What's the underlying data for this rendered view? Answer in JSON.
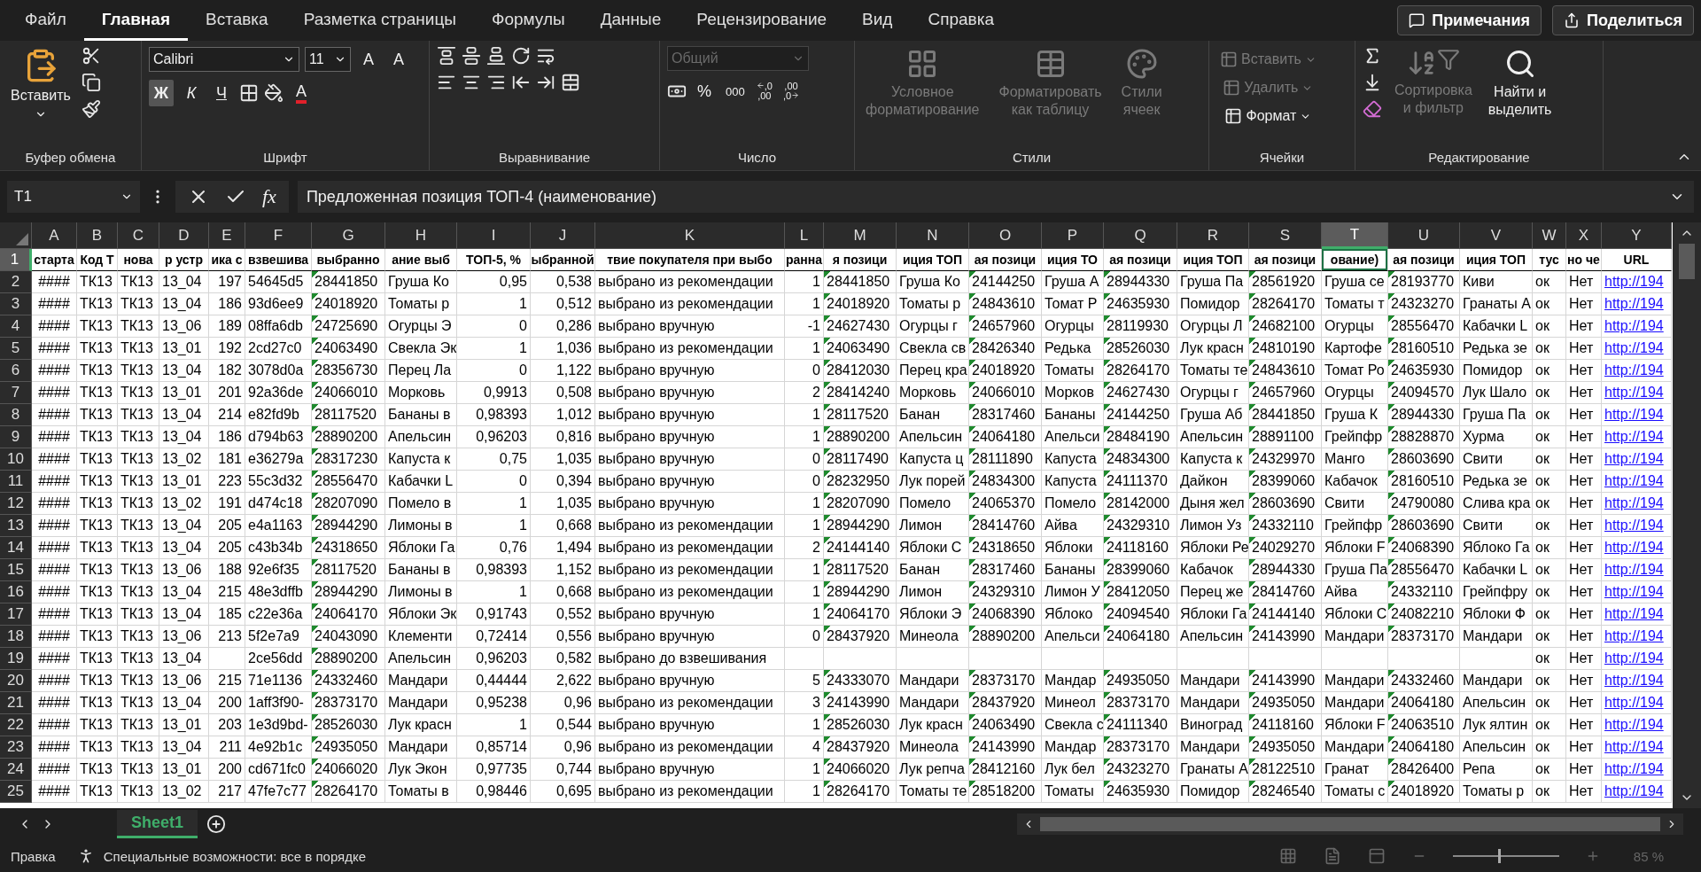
{
  "menu_tabs": [
    {
      "label": "Файл",
      "selected": false
    },
    {
      "label": "Главная",
      "selected": true
    },
    {
      "label": "Вставка",
      "selected": false
    },
    {
      "label": "Разметка страницы",
      "selected": false
    },
    {
      "label": "Формулы",
      "selected": false
    },
    {
      "label": "Данные",
      "selected": false
    },
    {
      "label": "Рецензирование",
      "selected": false
    },
    {
      "label": "Вид",
      "selected": false
    },
    {
      "label": "Справка",
      "selected": false
    }
  ],
  "actions": [
    {
      "label": "Примечания",
      "kind": "comments"
    },
    {
      "label": "Поделиться",
      "kind": "share"
    }
  ],
  "ribbon": [
    {
      "kind": "clipboard",
      "label": "Буфер обмена",
      "paste": "Вставить"
    },
    {
      "kind": "font",
      "label": "Шрифт",
      "font": "Calibri",
      "size": "11",
      "grow": "A",
      "shrink": "A",
      "font_color": "A",
      "styles": [
        {
          "label": "Ж",
          "selected": true
        },
        {
          "label": "К",
          "selected": false
        },
        {
          "label": "Ч",
          "selected": false
        }
      ]
    },
    {
      "kind": "alignment",
      "label": "Выравнивание"
    },
    {
      "kind": "number",
      "label": "Число",
      "format": "Общий",
      "format_disabled": true,
      "percent": "%",
      "thousands": "000",
      "decimals": [
        {
          "top": ",0",
          "bottom": ",00"
        },
        {
          "top": ",00",
          "bottom": ",0"
        }
      ]
    },
    {
      "kind": "styles",
      "label": "Стили",
      "items": [
        {
          "lines": [
            "Условное",
            "форматирование"
          ],
          "disabled": true
        },
        {
          "lines": [
            "Форматировать",
            "как таблицу"
          ],
          "disabled": true
        },
        {
          "lines": [
            "Стили",
            "ячеек"
          ],
          "disabled": true
        }
      ]
    },
    {
      "kind": "cells",
      "label": "Ячейки",
      "items": [
        {
          "label": "Вставить",
          "disabled": true
        },
        {
          "label": "Удалить",
          "disabled": true
        },
        {
          "label": "Формат",
          "disabled": false
        }
      ]
    },
    {
      "kind": "editing",
      "label": "Редактирование",
      "items": [
        {
          "lines": [
            "Сортировка",
            "и фильтр"
          ],
          "disabled": true
        },
        {
          "lines": [
            "Найти и",
            "выделить"
          ],
          "disabled": false
        }
      ]
    }
  ],
  "formula_bar": {
    "name_box": "T1",
    "fx": "fx",
    "formula": "Предложенная позиция ТОП-4 (наименование)"
  },
  "sheet": {
    "columns": [
      {
        "letter": "A",
        "selected": false,
        "kind": "center",
        "flagged": false
      },
      {
        "letter": "B",
        "selected": false,
        "kind": "text",
        "flagged": false
      },
      {
        "letter": "C",
        "selected": false,
        "kind": "text",
        "flagged": false
      },
      {
        "letter": "D",
        "selected": false,
        "kind": "text",
        "flagged": false
      },
      {
        "letter": "E",
        "selected": false,
        "kind": "number",
        "flagged": false
      },
      {
        "letter": "F",
        "selected": false,
        "kind": "text",
        "flagged": false
      },
      {
        "letter": "G",
        "selected": false,
        "kind": "text",
        "flagged": true
      },
      {
        "letter": "H",
        "selected": false,
        "kind": "text",
        "flagged": false
      },
      {
        "letter": "I",
        "selected": false,
        "kind": "number",
        "flagged": false
      },
      {
        "letter": "J",
        "selected": false,
        "kind": "number",
        "flagged": false
      },
      {
        "letter": "K",
        "selected": false,
        "kind": "text",
        "flagged": false
      },
      {
        "letter": "L",
        "selected": false,
        "kind": "number",
        "flagged": false
      },
      {
        "letter": "M",
        "selected": false,
        "kind": "text",
        "flagged": true
      },
      {
        "letter": "N",
        "selected": false,
        "kind": "text",
        "flagged": false
      },
      {
        "letter": "O",
        "selected": false,
        "kind": "text",
        "flagged": true
      },
      {
        "letter": "P",
        "selected": false,
        "kind": "text",
        "flagged": false
      },
      {
        "letter": "Q",
        "selected": false,
        "kind": "text",
        "flagged": true
      },
      {
        "letter": "R",
        "selected": false,
        "kind": "text",
        "flagged": false
      },
      {
        "letter": "S",
        "selected": false,
        "kind": "text",
        "flagged": true
      },
      {
        "letter": "T",
        "selected": true,
        "kind": "text",
        "flagged": false
      },
      {
        "letter": "U",
        "selected": false,
        "kind": "text",
        "flagged": true
      },
      {
        "letter": "V",
        "selected": false,
        "kind": "text",
        "flagged": false
      },
      {
        "letter": "W",
        "selected": false,
        "kind": "text",
        "flagged": false
      },
      {
        "letter": "X",
        "selected": false,
        "kind": "text",
        "flagged": false
      },
      {
        "letter": "Y",
        "selected": false,
        "kind": "link",
        "flagged": false
      }
    ],
    "header_row": {
      "number": "1",
      "selected": true,
      "cells": [
        "старта",
        "Код Т",
        "нова",
        "р устр",
        "ика с",
        "взвешива",
        "выбранно",
        "ание выб",
        "ТОП-5, %",
        "ыбранной",
        "твие покупателя при выбо",
        "ранна",
        "я позици",
        "иция ТОП",
        "ая позици",
        "иция ТО",
        "ая позици",
        "иция ТОП",
        "ая позици",
        "ование)",
        "ая позици",
        "иция ТОП",
        "тус",
        "но че",
        "URL"
      ]
    },
    "rows": [
      {
        "number": "2",
        "selected": false,
        "cells": [
          "####",
          "ТК13",
          "ТК13",
          "13_04",
          "197",
          "54645d5",
          "28441850",
          "Груша Ко",
          "0,95",
          "0,538",
          "выбрано из рекомендации",
          "1",
          "28441850",
          "Груша Ко",
          "24144250",
          "Груша А",
          "28944330",
          "Груша Па",
          "28561920",
          "Груша се",
          "28193770",
          "Киви",
          "ок",
          "Нет",
          "http://194"
        ]
      },
      {
        "number": "3",
        "selected": false,
        "cells": [
          "####",
          "ТК13",
          "ТК13",
          "13_04",
          "186",
          "93d6ee9",
          "24018920",
          "Томаты р",
          "1",
          "0,512",
          "выбрано из рекомендации",
          "1",
          "24018920",
          "Томаты р",
          "24843610",
          "Томат Р",
          "24635930",
          "Помидор",
          "28264170",
          "Томаты т",
          "24323270",
          "Гранаты А",
          "ок",
          "Нет",
          "http://194"
        ]
      },
      {
        "number": "4",
        "selected": false,
        "cells": [
          "####",
          "ТК13",
          "ТК13",
          "13_06",
          "189",
          "08ffa6db",
          "24725690",
          "Огурцы Э",
          "0",
          "0,286",
          "выбрано вручную",
          "-1",
          "24627430",
          "Огурцы г",
          "24657960",
          "Огурцы",
          "28119930",
          "Огурцы Л",
          "24682100",
          "Огурцы",
          "28556470",
          "Кабачки L",
          "ок",
          "Нет",
          "http://194"
        ]
      },
      {
        "number": "5",
        "selected": false,
        "cells": [
          "####",
          "ТК13",
          "ТК13",
          "13_01",
          "192",
          "2cd27c0",
          "24063490",
          "Свекла Эк",
          "1",
          "1,036",
          "выбрано из рекомендации",
          "1",
          "24063490",
          "Свекла св",
          "28426340",
          "Редька",
          "28526030",
          "Лук красн",
          "24810190",
          "Картофе",
          "28160510",
          "Редька зе",
          "ок",
          "Нет",
          "http://194"
        ]
      },
      {
        "number": "6",
        "selected": false,
        "cells": [
          "####",
          "ТК13",
          "ТК13",
          "13_04",
          "182",
          "3078d0a",
          "28356730",
          "Перец Ла",
          "0",
          "1,122",
          "выбрано вручную",
          "0",
          "28412030",
          "Перец кра",
          "24018920",
          "Томаты",
          "28264170",
          "Томаты те",
          "24843610",
          "Томат Ро",
          "24635930",
          "Помидор",
          "ок",
          "Нет",
          "http://194"
        ]
      },
      {
        "number": "7",
        "selected": false,
        "cells": [
          "####",
          "ТК13",
          "ТК13",
          "13_01",
          "201",
          "92a36de",
          "24066010",
          "Морковь",
          "0,9913",
          "0,508",
          "выбрано вручную",
          "2",
          "28414240",
          "Морковь",
          "24066010",
          "Морков",
          "24627430",
          "Огурцы г",
          "24657960",
          "Огурцы",
          "24094570",
          "Лук Шало",
          "ок",
          "Нет",
          "http://194"
        ]
      },
      {
        "number": "8",
        "selected": false,
        "cells": [
          "####",
          "ТК13",
          "ТК13",
          "13_04",
          "214",
          "e82fd9b",
          "28117520",
          "Бананы в",
          "0,98393",
          "1,012",
          "выбрано вручную",
          "1",
          "28117520",
          "Банан",
          "28317460",
          "Бананы",
          "24144250",
          "Груша Аб",
          "28441850",
          "Груша К",
          "28944330",
          "Груша Па",
          "ок",
          "Нет",
          "http://194"
        ]
      },
      {
        "number": "9",
        "selected": false,
        "cells": [
          "####",
          "ТК13",
          "ТК13",
          "13_04",
          "186",
          "d794b63",
          "28890200",
          "Апельсин",
          "0,96203",
          "0,816",
          "выбрано вручную",
          "1",
          "28890200",
          "Апельсин",
          "24064180",
          "Апельси",
          "28484190",
          "Апельсин",
          "28891100",
          "Грейпфр",
          "28828870",
          "Хурма",
          "ок",
          "Нет",
          "http://194"
        ]
      },
      {
        "number": "10",
        "selected": false,
        "cells": [
          "####",
          "ТК13",
          "ТК13",
          "13_02",
          "181",
          "e36279a",
          "28317230",
          "Капуста к",
          "0,75",
          "1,035",
          "выбрано вручную",
          "0",
          "28117490",
          "Капуста ц",
          "28111890",
          "Капуста",
          "24834300",
          "Капуста к",
          "24329970",
          "Манго",
          "28603690",
          "Свити",
          "ок",
          "Нет",
          "http://194"
        ]
      },
      {
        "number": "11",
        "selected": false,
        "cells": [
          "####",
          "ТК13",
          "ТК13",
          "13_01",
          "223",
          "55c3d32",
          "28556470",
          "Кабачки L",
          "0",
          "0,394",
          "выбрано вручную",
          "0",
          "28232950",
          "Лук порей",
          "24834300",
          "Капуста",
          "24111370",
          "Дайкон",
          "28399060",
          "Кабачок",
          "28160510",
          "Редька зе",
          "ок",
          "Нет",
          "http://194"
        ]
      },
      {
        "number": "12",
        "selected": false,
        "cells": [
          "####",
          "ТК13",
          "ТК13",
          "13_02",
          "191",
          "d474c18",
          "28207090",
          "Помело в",
          "1",
          "1,035",
          "выбрано вручную",
          "1",
          "28207090",
          "Помело",
          "24065370",
          "Помело",
          "28142000",
          "Дыня жел",
          "28603690",
          "Свити",
          "24790080",
          "Слива кра",
          "ок",
          "Нет",
          "http://194"
        ]
      },
      {
        "number": "13",
        "selected": false,
        "cells": [
          "####",
          "ТК13",
          "ТК13",
          "13_04",
          "205",
          "e4a1163",
          "28944290",
          "Лимоны в",
          "1",
          "0,668",
          "выбрано из рекомендации",
          "1",
          "28944290",
          "Лимон",
          "28414760",
          "Айва",
          "24329310",
          "Лимон Уз",
          "24332110",
          "Грейпфр",
          "28603690",
          "Свити",
          "ок",
          "Нет",
          "http://194"
        ]
      },
      {
        "number": "14",
        "selected": false,
        "cells": [
          "####",
          "ТК13",
          "ТК13",
          "13_04",
          "205",
          "c43b34b",
          "24318650",
          "Яблоки Га",
          "0,76",
          "1,494",
          "выбрано из рекомендации",
          "2",
          "24144140",
          "Яблоки С",
          "24318650",
          "Яблоки",
          "24118160",
          "Яблоки Ре",
          "24029270",
          "Яблоки F",
          "24068390",
          "Яблоко Га",
          "ок",
          "Нет",
          "http://194"
        ]
      },
      {
        "number": "15",
        "selected": false,
        "cells": [
          "####",
          "ТК13",
          "ТК13",
          "13_06",
          "188",
          "92e6f35",
          "28117520",
          "Бананы в",
          "0,98393",
          "1,152",
          "выбрано из рекомендации",
          "1",
          "28117520",
          "Банан",
          "28317460",
          "Бананы",
          "28399060",
          "Кабачок",
          "28944330",
          "Груша Па",
          "28556470",
          "Кабачки L",
          "ок",
          "Нет",
          "http://194"
        ]
      },
      {
        "number": "16",
        "selected": false,
        "cells": [
          "####",
          "ТК13",
          "ТК13",
          "13_04",
          "215",
          "48e3dffb",
          "28944290",
          "Лимоны в",
          "1",
          "0,668",
          "выбрано из рекомендации",
          "1",
          "28944290",
          "Лимон",
          "24329310",
          "Лимон У",
          "28412050",
          "Перец же",
          "28414760",
          "Айва",
          "24332110",
          "Грейпфру",
          "ок",
          "Нет",
          "http://194"
        ]
      },
      {
        "number": "17",
        "selected": false,
        "cells": [
          "####",
          "ТК13",
          "ТК13",
          "13_04",
          "185",
          "c22e36a",
          "24064170",
          "Яблоки Эк",
          "0,91743",
          "0,552",
          "выбрано вручную",
          "1",
          "24064170",
          "Яблоки Э",
          "24068390",
          "Яблоко",
          "24094540",
          "Яблоки Га",
          "24144140",
          "Яблоки С",
          "24082210",
          "Яблоки Ф",
          "ок",
          "Нет",
          "http://194"
        ]
      },
      {
        "number": "18",
        "selected": false,
        "cells": [
          "####",
          "ТК13",
          "ТК13",
          "13_06",
          "213",
          "5f2e7a9",
          "24043090",
          "Клементи",
          "0,72414",
          "0,556",
          "выбрано вручную",
          "0",
          "28437920",
          "Минеола",
          "28890200",
          "Апельси",
          "24064180",
          "Апельсин",
          "24143990",
          "Мандари",
          "28373170",
          "Мандари",
          "ок",
          "Нет",
          "http://194"
        ]
      },
      {
        "number": "19",
        "selected": false,
        "cells": [
          "####",
          "ТК13",
          "ТК13",
          "13_04",
          null,
          "2ce56dd",
          "28890200",
          "Апельсин",
          "0,96203",
          "0,582",
          "выбрано до взвешивания",
          null,
          null,
          null,
          null,
          null,
          null,
          null,
          null,
          null,
          null,
          null,
          "ок",
          "Нет",
          "http://194"
        ]
      },
      {
        "number": "20",
        "selected": false,
        "cells": [
          "####",
          "ТК13",
          "ТК13",
          "13_06",
          "215",
          "71e1136",
          "24332460",
          "Мандари",
          "0,44444",
          "2,622",
          "выбрано вручную",
          "5",
          "24333070",
          "Мандари",
          "28373170",
          "Мандар",
          "24935050",
          "Мандари",
          "24143990",
          "Мандари",
          "24332460",
          "Мандари",
          "ок",
          "Нет",
          "http://194"
        ]
      },
      {
        "number": "21",
        "selected": false,
        "cells": [
          "####",
          "ТК13",
          "ТК13",
          "13_04",
          "200",
          "1aff3f90-",
          "28373170",
          "Мандари",
          "0,95238",
          "0,96",
          "выбрано из рекомендации",
          "3",
          "24143990",
          "Мандари",
          "28437920",
          "Минеол",
          "28373170",
          "Мандари",
          "24935050",
          "Мандари",
          "24064180",
          "Апельсин",
          "ок",
          "Нет",
          "http://194"
        ]
      },
      {
        "number": "22",
        "selected": false,
        "cells": [
          "####",
          "ТК13",
          "ТК13",
          "13_01",
          "203",
          "1e3d9bd-",
          "28526030",
          "Лук красн",
          "1",
          "0,544",
          "выбрано вручную",
          "1",
          "28526030",
          "Лук красн",
          "24063490",
          "Свекла с",
          "24111340",
          "Виноград",
          "24118160",
          "Яблоки F",
          "24063510",
          "Лук ялтин",
          "ок",
          "Нет",
          "http://194"
        ]
      },
      {
        "number": "23",
        "selected": false,
        "cells": [
          "####",
          "ТК13",
          "ТК13",
          "13_04",
          "211",
          "4e92b1c",
          "24935050",
          "Мандари",
          "0,85714",
          "0,96",
          "выбрано из рекомендации",
          "4",
          "28437920",
          "Минеола",
          "24143990",
          "Мандар",
          "28373170",
          "Мандари",
          "24935050",
          "Мандари",
          "24064180",
          "Апельсин",
          "ок",
          "Нет",
          "http://194"
        ]
      },
      {
        "number": "24",
        "selected": false,
        "cells": [
          "####",
          "ТК13",
          "ТК13",
          "13_01",
          "200",
          "cd671fc0",
          "24066020",
          "Лук Экон",
          "0,97735",
          "0,744",
          "выбрано вручную",
          "1",
          "24066020",
          "Лук репча",
          "28412160",
          "Лук бел",
          "24323270",
          "Гранаты А",
          "28122510",
          "Гранат",
          "28426400",
          "Репа",
          "ок",
          "Нет",
          "http://194"
        ]
      },
      {
        "number": "25",
        "selected": false,
        "cells": [
          "####",
          "ТК13",
          "ТК13",
          "13_02",
          "217",
          "47fe7c77",
          "28264170",
          "Томаты в",
          "0,98446",
          "0,695",
          "выбрано из рекомендации",
          "1",
          "28264170",
          "Томаты те",
          "28518200",
          "Томаты",
          "24635930",
          "Помидор",
          "28246540",
          "Томаты с",
          "24018920",
          "Томаты р",
          "ок",
          "Нет",
          "http://194"
        ]
      }
    ]
  },
  "sheet_tabs": [
    {
      "label": "Sheet1",
      "selected": true
    }
  ],
  "status_bar": {
    "mode": "Правка",
    "accessibility": "Специальные возможности: все в порядке",
    "zoom": "85 %",
    "zoom_slider": {
      "level": 0.43
    }
  }
}
